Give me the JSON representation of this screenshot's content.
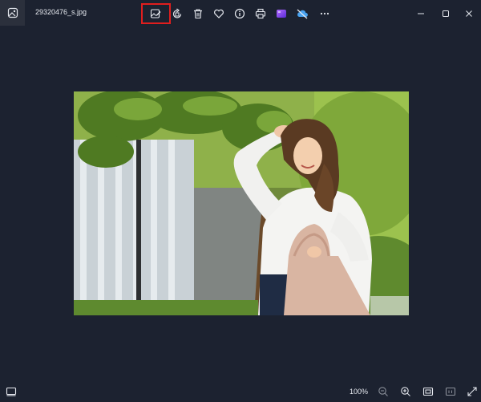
{
  "window": {
    "file_name": "29320476_s.jpg"
  },
  "toolbar": {
    "items": [
      {
        "icon": "edit-image-icon",
        "highlighted": true
      },
      {
        "icon": "rotate-icon"
      },
      {
        "icon": "delete-icon"
      },
      {
        "icon": "favorite-icon"
      },
      {
        "icon": "info-icon"
      },
      {
        "icon": "print-icon"
      },
      {
        "icon": "clipchamp-icon"
      },
      {
        "icon": "onedrive-offline-icon"
      },
      {
        "icon": "more-icon"
      }
    ],
    "highlight_color": "#e01e1e"
  },
  "window_controls": {
    "items": [
      "minimize-icon",
      "maximize-icon",
      "close-icon"
    ]
  },
  "statusbar": {
    "zoom_label": "100%",
    "items": [
      "filmstrip-icon",
      "zoom-out-icon",
      "zoom-in-icon",
      "fit-window-icon",
      "actual-size-icon",
      "fullscreen-icon"
    ]
  },
  "colors": {
    "background": "#1c2230",
    "accent_purple": "#7a3ff2",
    "onedrive_blue": "#4aa3f0"
  }
}
